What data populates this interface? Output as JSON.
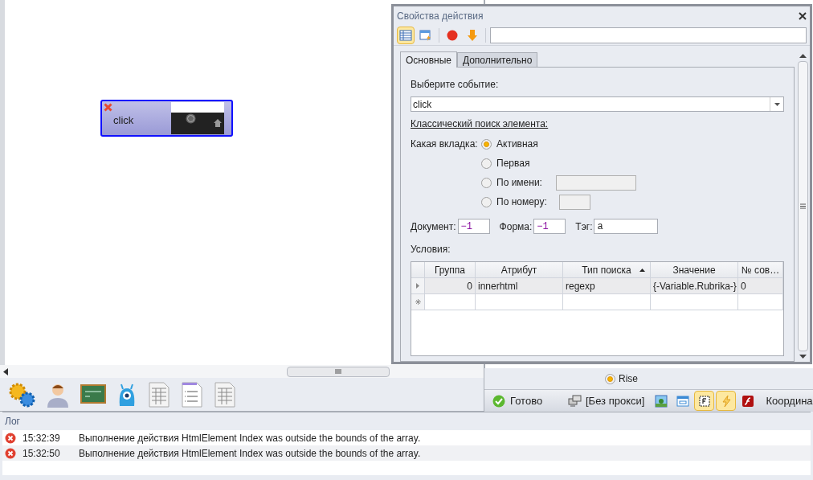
{
  "canvas": {
    "node": {
      "label": "click"
    }
  },
  "dialog": {
    "title": "Свойства действия",
    "tools": [
      {
        "kind": "grid",
        "selected": true
      },
      {
        "kind": "window-bolt",
        "selected": false
      },
      {
        "kind": "record",
        "selected": false
      },
      {
        "kind": "arrow-down",
        "selected": false
      }
    ],
    "tabs": [
      {
        "label": "Основные",
        "selected": true
      },
      {
        "label": "Дополнительно",
        "selected": false
      }
    ],
    "event_label": "Выберите событие:",
    "event_value": "click",
    "section_title": "Классический поиск элемента:",
    "tab_label": "Какая вкладка:",
    "tab_options": [
      {
        "label": "Активная",
        "selected": true,
        "kind": "plain"
      },
      {
        "label": "Первая",
        "selected": false,
        "kind": "plain"
      },
      {
        "label": "По имени:",
        "selected": false,
        "kind": "wide"
      },
      {
        "label": "По номеру:",
        "selected": false,
        "kind": "narrow"
      }
    ],
    "fields": [
      {
        "label": "Документ:",
        "value": "−1",
        "kind": "number"
      },
      {
        "label": "Форма:",
        "value": "−1",
        "kind": "number"
      },
      {
        "label": "Тэг:",
        "value": "a",
        "kind": "text"
      }
    ],
    "conditions": {
      "label": "Условия:",
      "columns": [
        {
          "label": "Группа",
          "sorted": false
        },
        {
          "label": "Атрибут",
          "sorted": false
        },
        {
          "label": "Тип поиска",
          "sorted": true
        },
        {
          "label": "Значение",
          "sorted": false
        },
        {
          "label": "№ сов…",
          "sorted": false
        }
      ],
      "rows": [
        {
          "cells": [
            "0",
            "innerhtml",
            "regexp",
            "{-Variable.Rubrika-}",
            "0"
          ],
          "selected": true
        }
      ]
    }
  },
  "rise": {
    "label": "Rise",
    "selected": true
  },
  "status_bar": {
    "status": "Готово",
    "proxy": "[Без прокси]",
    "tools": [
      {
        "kind": "picture",
        "selected": false
      },
      {
        "kind": "window",
        "selected": false
      },
      {
        "kind": "frame",
        "selected": true
      },
      {
        "kind": "bolt",
        "selected": true
      },
      {
        "kind": "flash",
        "selected": false
      }
    ],
    "coordinates": "Координа"
  },
  "log": {
    "title": "Лог",
    "entries": [
      {
        "time": "15:32:39",
        "message": "Выполнение действия HtmlElement Index was outside the bounds of the array."
      },
      {
        "time": "15:32:50",
        "message": "Выполнение действия HtmlElement Index was outside the bounds of the array."
      }
    ]
  }
}
